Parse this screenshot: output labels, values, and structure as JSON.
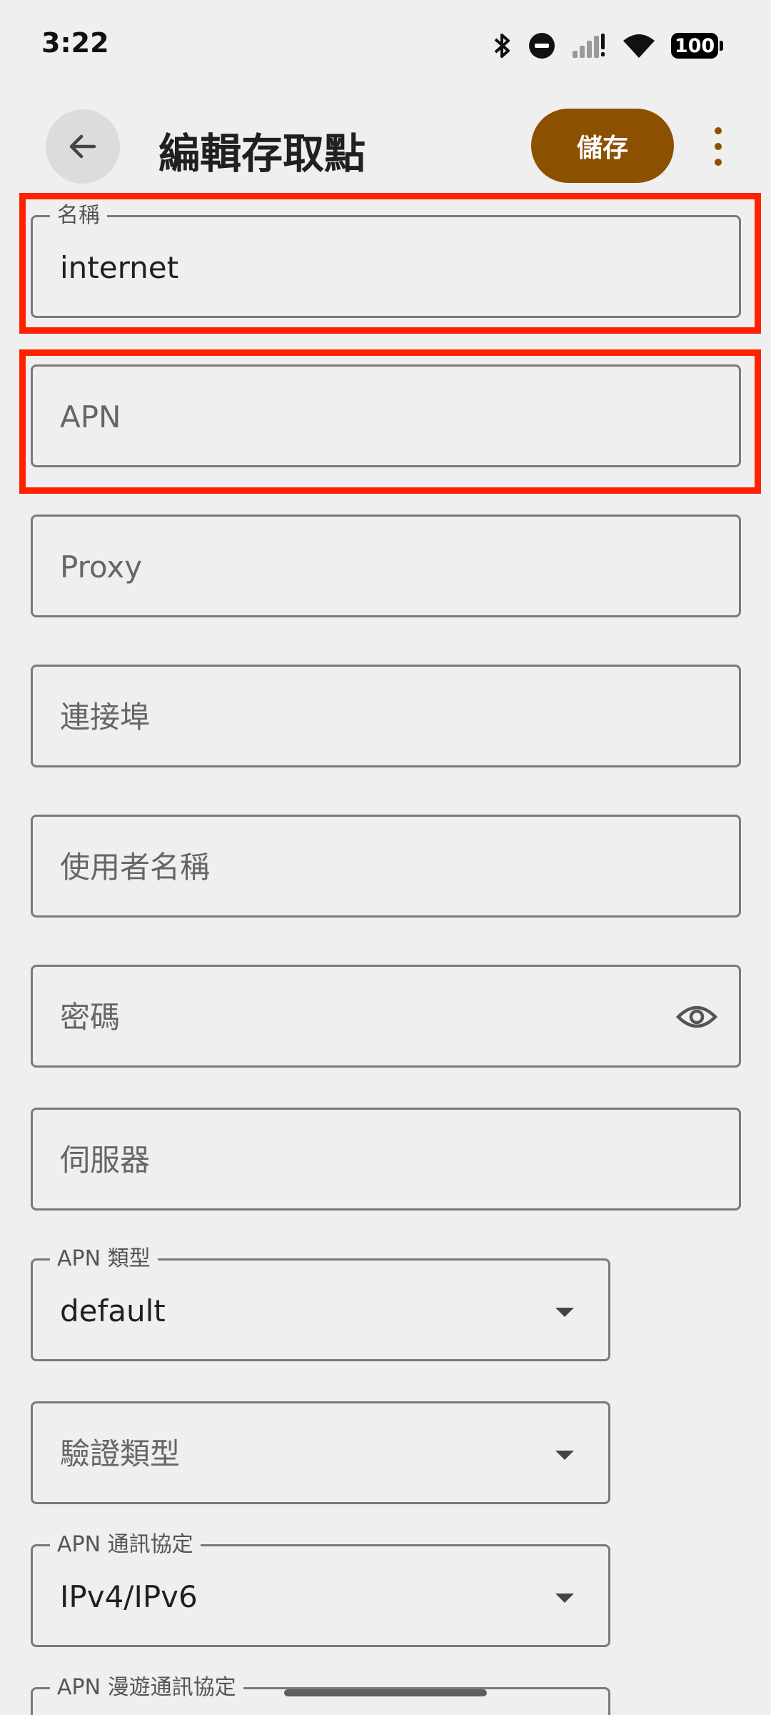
{
  "status_bar": {
    "time": "3:22",
    "battery": "100",
    "icons": [
      "bluetooth-icon",
      "do-not-disturb-icon",
      "cell-signal-icon",
      "wifi-icon",
      "battery-icon"
    ]
  },
  "app_bar": {
    "title": "編輯存取點",
    "save_label": "儲存",
    "back_icon": "arrow-back-icon",
    "more_icon": "more-vert-icon",
    "accent_color": "#8b5000"
  },
  "fields": {
    "name": {
      "label": "名稱",
      "value": "internet"
    },
    "apn": {
      "placeholder": "APN"
    },
    "proxy": {
      "placeholder": "Proxy"
    },
    "port": {
      "placeholder": "連接埠"
    },
    "username": {
      "placeholder": "使用者名稱"
    },
    "password": {
      "placeholder": "密碼",
      "icon": "eye-icon"
    },
    "server": {
      "placeholder": "伺服器"
    },
    "apn_type": {
      "label": "APN 類型",
      "value": "default"
    },
    "auth_type": {
      "placeholder": "驗證類型"
    },
    "apn_protocol": {
      "label": "APN 通訊協定",
      "value": "IPv4/IPv6"
    },
    "apn_roaming_protocol": {
      "label": "APN 漫遊通訊協定"
    }
  },
  "highlight_color": "#ff2200"
}
